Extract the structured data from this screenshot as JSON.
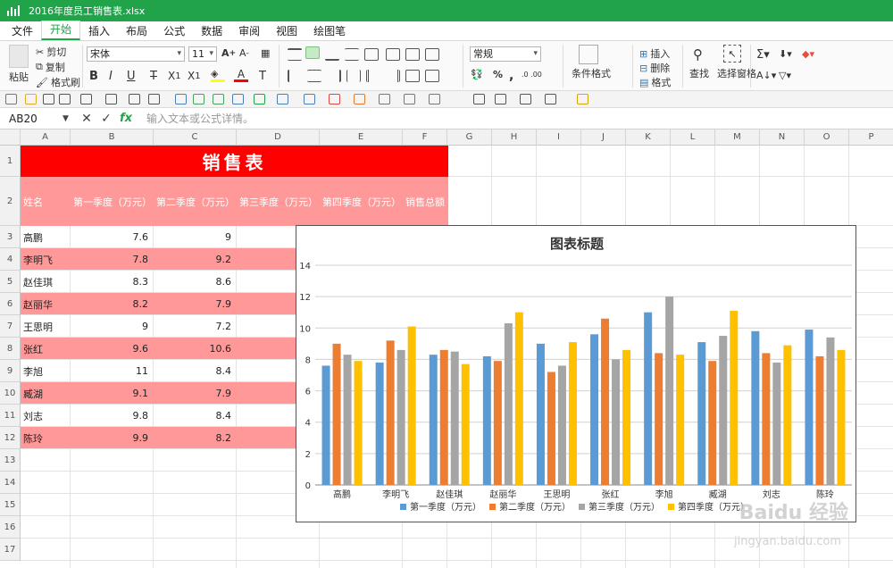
{
  "window": {
    "title": "2016年度员工销售表.xlsx"
  },
  "menu": [
    "文件",
    "开始",
    "插入",
    "布局",
    "公式",
    "数据",
    "审阅",
    "视图",
    "绘图笔"
  ],
  "menu_active": "开始",
  "ribbon": {
    "paste": "粘贴",
    "cut": "剪切",
    "copy": "复制",
    "format_painter": "格式刷",
    "font_name": "宋体",
    "font_size": "11",
    "number_format": "常规",
    "conditional_format": "条件格式",
    "insert": "插入",
    "delete": "删除",
    "format": "格式",
    "find": "查找",
    "select_pane": "选择窗格"
  },
  "formula_bar": {
    "name_box": "AB20",
    "placeholder": "输入文本或公式详情。"
  },
  "columns": [
    "A",
    "B",
    "C",
    "D",
    "E",
    "F",
    "G",
    "H",
    "I",
    "J",
    "K",
    "L",
    "M",
    "N",
    "O",
    "P"
  ],
  "rows": [
    "1",
    "2",
    "3",
    "4",
    "5",
    "6",
    "7",
    "8",
    "9",
    "10",
    "11",
    "12",
    "13",
    "14",
    "15",
    "16",
    "17"
  ],
  "sheet": {
    "title": "销售表",
    "headers": [
      "姓名",
      "第一季度（万元）",
      "第二季度（万元）",
      "第三季度（万元）",
      "第四季度（万元）",
      "销售总额"
    ],
    "names": [
      "高鹏",
      "李明飞",
      "赵佳琪",
      "赵丽华",
      "王思明",
      "张红",
      "李旭",
      "臧湖",
      "刘志",
      "陈玲"
    ],
    "q1": [
      "7.6",
      "7.8",
      "8.3",
      "8.2",
      "9",
      "9.6",
      "11",
      "9.1",
      "9.8",
      "9.9"
    ],
    "q2": [
      "9",
      "9.2",
      "8.6",
      "7.9",
      "7.2",
      "10.6",
      "8.4",
      "7.9",
      "8.4",
      "8.2"
    ]
  },
  "chart_data": {
    "type": "bar",
    "title": "图表标题",
    "categories": [
      "高鹏",
      "李明飞",
      "赵佳琪",
      "赵丽华",
      "王思明",
      "张红",
      "李旭",
      "臧湖",
      "刘志",
      "陈玲"
    ],
    "ylim": [
      0,
      14
    ],
    "yticks": [
      "0",
      "2",
      "4",
      "6",
      "8",
      "10",
      "12",
      "14"
    ],
    "grid": true,
    "legend_position": "bottom",
    "series": [
      {
        "name": "第一季度（万元）",
        "color": "#5b9bd5",
        "values": [
          7.6,
          7.8,
          8.3,
          8.2,
          9,
          9.6,
          11,
          9.1,
          9.8,
          9.9
        ]
      },
      {
        "name": "第二季度（万元）",
        "color": "#ed7d31",
        "values": [
          9,
          9.2,
          8.6,
          7.9,
          7.2,
          10.6,
          8.4,
          7.9,
          8.4,
          8.2
        ]
      },
      {
        "name": "第三季度（万元）",
        "color": "#a5a5a5",
        "values": [
          8.3,
          8.6,
          8.5,
          10.3,
          7.6,
          8,
          12,
          9.5,
          7.8,
          9.4
        ]
      },
      {
        "name": "第四季度（万元）",
        "color": "#ffc000",
        "values": [
          7.9,
          10.1,
          7.7,
          11,
          9.1,
          8.6,
          8.3,
          11.1,
          8.9,
          8.6
        ]
      }
    ]
  },
  "watermark": {
    "text": "Baidu经验",
    "url": "jingyan.baidu.com"
  }
}
